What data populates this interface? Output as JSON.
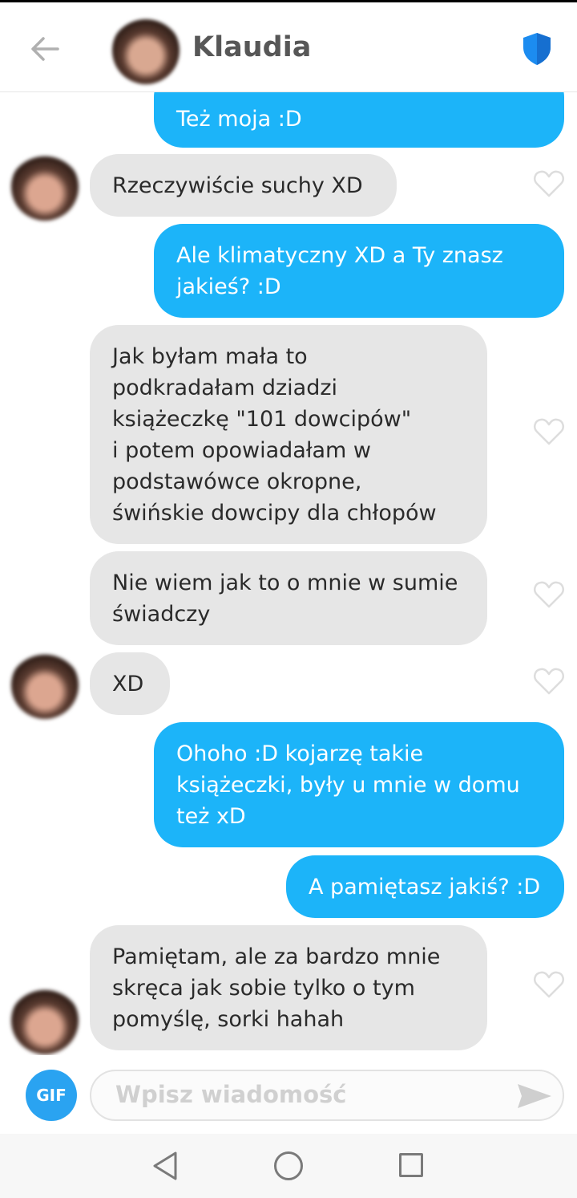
{
  "header": {
    "contact_name": "Klaudia",
    "back_icon": "arrow-left-icon",
    "safety_icon": "shield-icon",
    "shield_color": "#1c8cf0"
  },
  "messages": [
    {
      "side": "sent",
      "text": "Też moja :D"
    },
    {
      "side": "received",
      "text": "Rzeczywiście suchy XD"
    },
    {
      "side": "sent",
      "lines": [
        "Ale klimatyczny XD a Ty znasz",
        "jakieś? :D"
      ]
    },
    {
      "side": "received",
      "lines": [
        "Jak byłam mała to",
        "podkradałam dziadzi",
        "książeczkę \"101 dowcipów\"",
        "i potem opowiadałam w",
        "podstawówce okropne,",
        "świńskie dowcipy dla chłopów"
      ]
    },
    {
      "side": "received",
      "lines": [
        "Nie wiem jak to o mnie w sumie",
        "świadczy"
      ]
    },
    {
      "side": "received",
      "text": "XD"
    },
    {
      "side": "sent",
      "lines": [
        "Ohoho :D kojarzę takie",
        "książeczki, były u mnie w domu",
        "też xD"
      ]
    },
    {
      "side": "sent",
      "text": "A pamiętasz jakiś? :D"
    },
    {
      "side": "received",
      "lines": [
        "Pamiętam, ale za bardzo mnie",
        "skręca jak sobie tylko o tym",
        "pomyślę, sorki hahah"
      ]
    }
  ],
  "composer": {
    "gif_label": "GIF",
    "placeholder": "Wpisz wiadomość",
    "send_icon": "send-arrow-icon"
  },
  "colors": {
    "sent_bubble": "#1cb4f9",
    "received_bubble": "#e6e6e6"
  },
  "navbar": {
    "icons": [
      "back-triangle-icon",
      "home-circle-icon",
      "recents-square-icon"
    ]
  }
}
